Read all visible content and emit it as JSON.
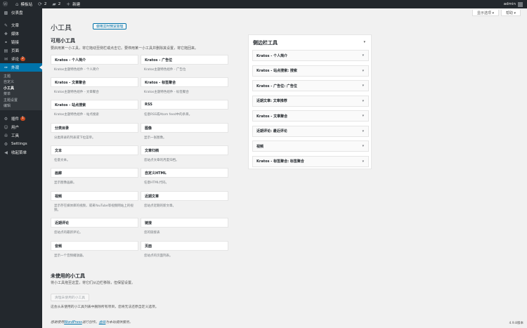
{
  "adminbar": {
    "wp_icon": "wordpress-logo-icon",
    "site_name": "模板站",
    "updates_count": "2",
    "comments_count": "2",
    "new_label": "新建",
    "user": "admin"
  },
  "sidebar": {
    "items": [
      {
        "label": "仪表盘",
        "icon": "▩"
      },
      {
        "label": "文章",
        "icon": "✎"
      },
      {
        "label": "媒体",
        "icon": "❖"
      },
      {
        "label": "链接",
        "icon": "⚭"
      },
      {
        "label": "页面",
        "icon": "▤"
      },
      {
        "label": "评论",
        "icon": "✉",
        "badge": "2"
      },
      {
        "label": "外观",
        "icon": "✑",
        "active": true
      },
      {
        "label": "插件",
        "icon": "⚙",
        "badge": "1"
      },
      {
        "label": "用户",
        "icon": "☺"
      },
      {
        "label": "工具",
        "icon": "✇"
      },
      {
        "label": "Settings",
        "icon": "⚙"
      },
      {
        "label": "收起菜单",
        "icon": "◀"
      }
    ],
    "submenu": [
      "主题",
      "自定义",
      "小工具",
      "菜单",
      "主题设置",
      "编辑"
    ]
  },
  "header": {
    "screen_options": "显示选项 ▾",
    "help": "帮助 ▾",
    "title": "小工具",
    "manage_button": "使用实时预览管理"
  },
  "available": {
    "title": "可用小工具",
    "description": "要启用某一小工具，将它拖动至侧栏或点击它。要停用某一小工具并删除其设置，将它拖回来。",
    "widgets": [
      {
        "name": "Kratos - 个人简介",
        "desc": "Kratos主题特色组件 - 个人简介"
      },
      {
        "name": "Kratos - 广告位",
        "desc": "Kratos主题特色组件 - 广告位"
      },
      {
        "name": "Kratos - 文章聚合",
        "desc": "Kratos主题特色组件 - 文章聚合"
      },
      {
        "name": "Kratos - 标签聚合",
        "desc": "Kratos主题特色组件 - 标签聚合"
      },
      {
        "name": "Kratos - 站点搜索",
        "desc": "Kratos主题特色组件 - 站点搜索"
      },
      {
        "name": "RSS",
        "desc": "任意RSS或Atom feed中的条目。"
      },
      {
        "name": "分类目录",
        "desc": "分类目录的列表或下拉菜单。"
      },
      {
        "name": "图像",
        "desc": "显示一张图像。"
      },
      {
        "name": "文本",
        "desc": "任意文本。"
      },
      {
        "name": "文章归档",
        "desc": "您站点文章的月度归档。"
      },
      {
        "name": "画廊",
        "desc": "显示图像画廊。"
      },
      {
        "name": "自定义HTML",
        "desc": "任意HTML代码。"
      },
      {
        "name": "视频",
        "desc": "显示存在媒体库的视频，或来YouTube等视频网站上的视频。"
      },
      {
        "name": "近期文章",
        "desc": "您站点近期的新文章。"
      },
      {
        "name": "近期评论",
        "desc": "您站点的最新评论。"
      },
      {
        "name": "链接",
        "desc": "您的链接表"
      },
      {
        "name": "音频",
        "desc": "显示一个音频播放器。"
      },
      {
        "name": "页面",
        "desc": "您站点的页面列表。"
      }
    ]
  },
  "inactive": {
    "title": "未使用的小工具",
    "description": "将小工具拖至这里，将它们从边栏移除，但保留设置。",
    "clear_button": "清理未使用的小工具",
    "note": "这会从未使用的小工具列表中删除所有项目，您将无法还原自定义选项。"
  },
  "sidebar_area": {
    "title": "侧边栏工具",
    "widgets": [
      "Kratos - 个人简介",
      "Kratos - 站点搜索: 搜索",
      "Kratos - 广告位: 广告位",
      "近期文章: 文章推荐",
      "Kratos - 文章聚合",
      "近期评论: 最近评论",
      "视频",
      "Kratos - 标签聚合: 标签聚合"
    ]
  },
  "footer": {
    "thanks_prefix": "感谢使用",
    "wordpress_link": "WordPress",
    "thanks_middle": "进行创作。",
    "host_link": "虚拟",
    "thanks_suffix": "为本站提供服务。",
    "version": "4.9.8版本"
  }
}
